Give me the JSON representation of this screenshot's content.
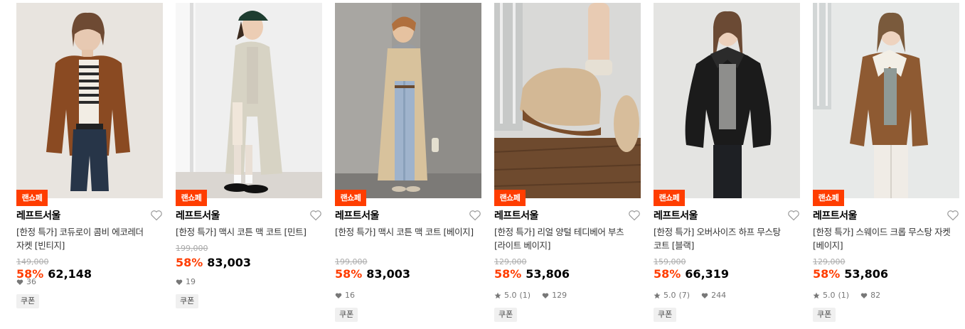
{
  "colors": {
    "accent": "#ff3d00",
    "text": "#000000",
    "muted": "#777777",
    "strike": "#aaaaaa",
    "coupon_bg": "#f0f0f0"
  },
  "products": [
    {
      "badge": "랜쇼페",
      "brand": "레프트서울",
      "name": "[한정 특가] 코듀로이 콤비 에코레더 자켓 [빈티지]",
      "original_price": "149,000",
      "discount": "58%",
      "price": "62,148",
      "rating": "",
      "reviews": "",
      "likes": "36",
      "coupon": "쿠폰",
      "image": "brown-leather-jacket"
    },
    {
      "badge": "랜쇼페",
      "brand": "레프트서울",
      "name": "[한정 특가] 맥시 코튼 맥 코트 [민트]",
      "original_price": "199,000",
      "discount": "58%",
      "price": "83,003",
      "rating": "",
      "reviews": "",
      "likes": "19",
      "coupon": "쿠폰",
      "image": "mint-mac-coat"
    },
    {
      "badge": "랜쇼페",
      "brand": "레프트서울",
      "name": "[한정 특가] 맥시 코튼 맥 코트 [베이지]",
      "original_price": "199,000",
      "discount": "58%",
      "price": "83,003",
      "rating": "",
      "reviews": "",
      "likes": "16",
      "coupon": "쿠폰",
      "image": "beige-mac-coat"
    },
    {
      "badge": "랜쇼페",
      "brand": "레프트서울",
      "name": "[한정 특가] 리얼 양털 테디베어 부츠 [라이트 베이지]",
      "original_price": "129,000",
      "discount": "58%",
      "price": "53,806",
      "rating": "5.0",
      "reviews": "(1)",
      "likes": "129",
      "coupon": "쿠폰",
      "image": "teddy-boots"
    },
    {
      "badge": "랜쇼페",
      "brand": "레프트서울",
      "name": "[한정 특가] 오버사이즈 하프 무스탕 코트 [블랙]",
      "original_price": "159,000",
      "discount": "58%",
      "price": "66,319",
      "rating": "5.0",
      "reviews": "(7)",
      "likes": "244",
      "coupon": "쿠폰",
      "image": "black-mustang-coat"
    },
    {
      "badge": "랜쇼페",
      "brand": "레프트서울",
      "name": "[한정 특가] 스웨이드 크롭 무스탕 자켓 [베이지]",
      "original_price": "129,000",
      "discount": "58%",
      "price": "53,806",
      "rating": "5.0",
      "reviews": "(1)",
      "likes": "82",
      "coupon": "쿠폰",
      "image": "suede-crop-mustang"
    }
  ]
}
